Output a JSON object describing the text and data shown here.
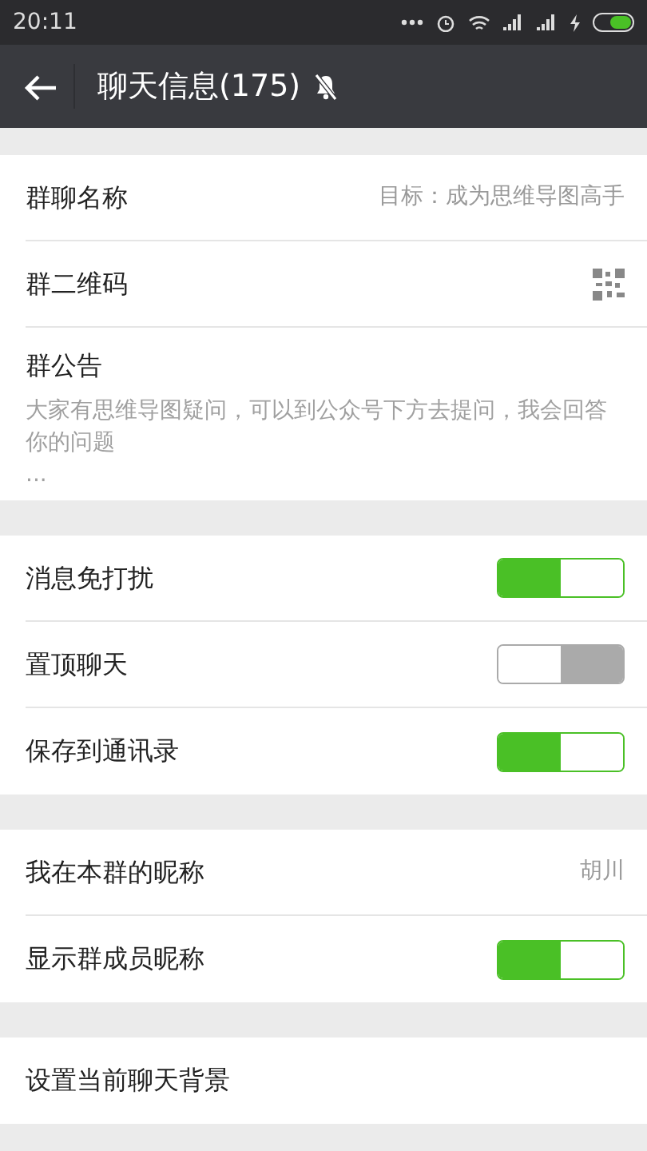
{
  "status_bar": {
    "time": "20:11"
  },
  "header": {
    "title": "聊天信息(175)",
    "muted": true
  },
  "groups": [
    {
      "items": [
        {
          "kind": "value",
          "label": "群聊名称",
          "value": "目标：成为思维导图高手"
        },
        {
          "kind": "qr",
          "label": "群二维码"
        },
        {
          "kind": "notice",
          "label": "群公告",
          "text": "大家有思维导图疑问，可以到公众号下方去提问，我会回答你的问题",
          "more": "..."
        }
      ]
    },
    {
      "items": [
        {
          "kind": "toggle",
          "label": "消息免打扰",
          "on": true
        },
        {
          "kind": "toggle",
          "label": "置顶聊天",
          "on": false
        },
        {
          "kind": "toggle",
          "label": "保存到通讯录",
          "on": true
        }
      ]
    },
    {
      "items": [
        {
          "kind": "value",
          "label": "我在本群的昵称",
          "value": "胡川"
        },
        {
          "kind": "toggle",
          "label": "显示群成员昵称",
          "on": true
        }
      ]
    },
    {
      "items": [
        {
          "kind": "plain",
          "label": "设置当前聊天背景"
        }
      ]
    }
  ]
}
